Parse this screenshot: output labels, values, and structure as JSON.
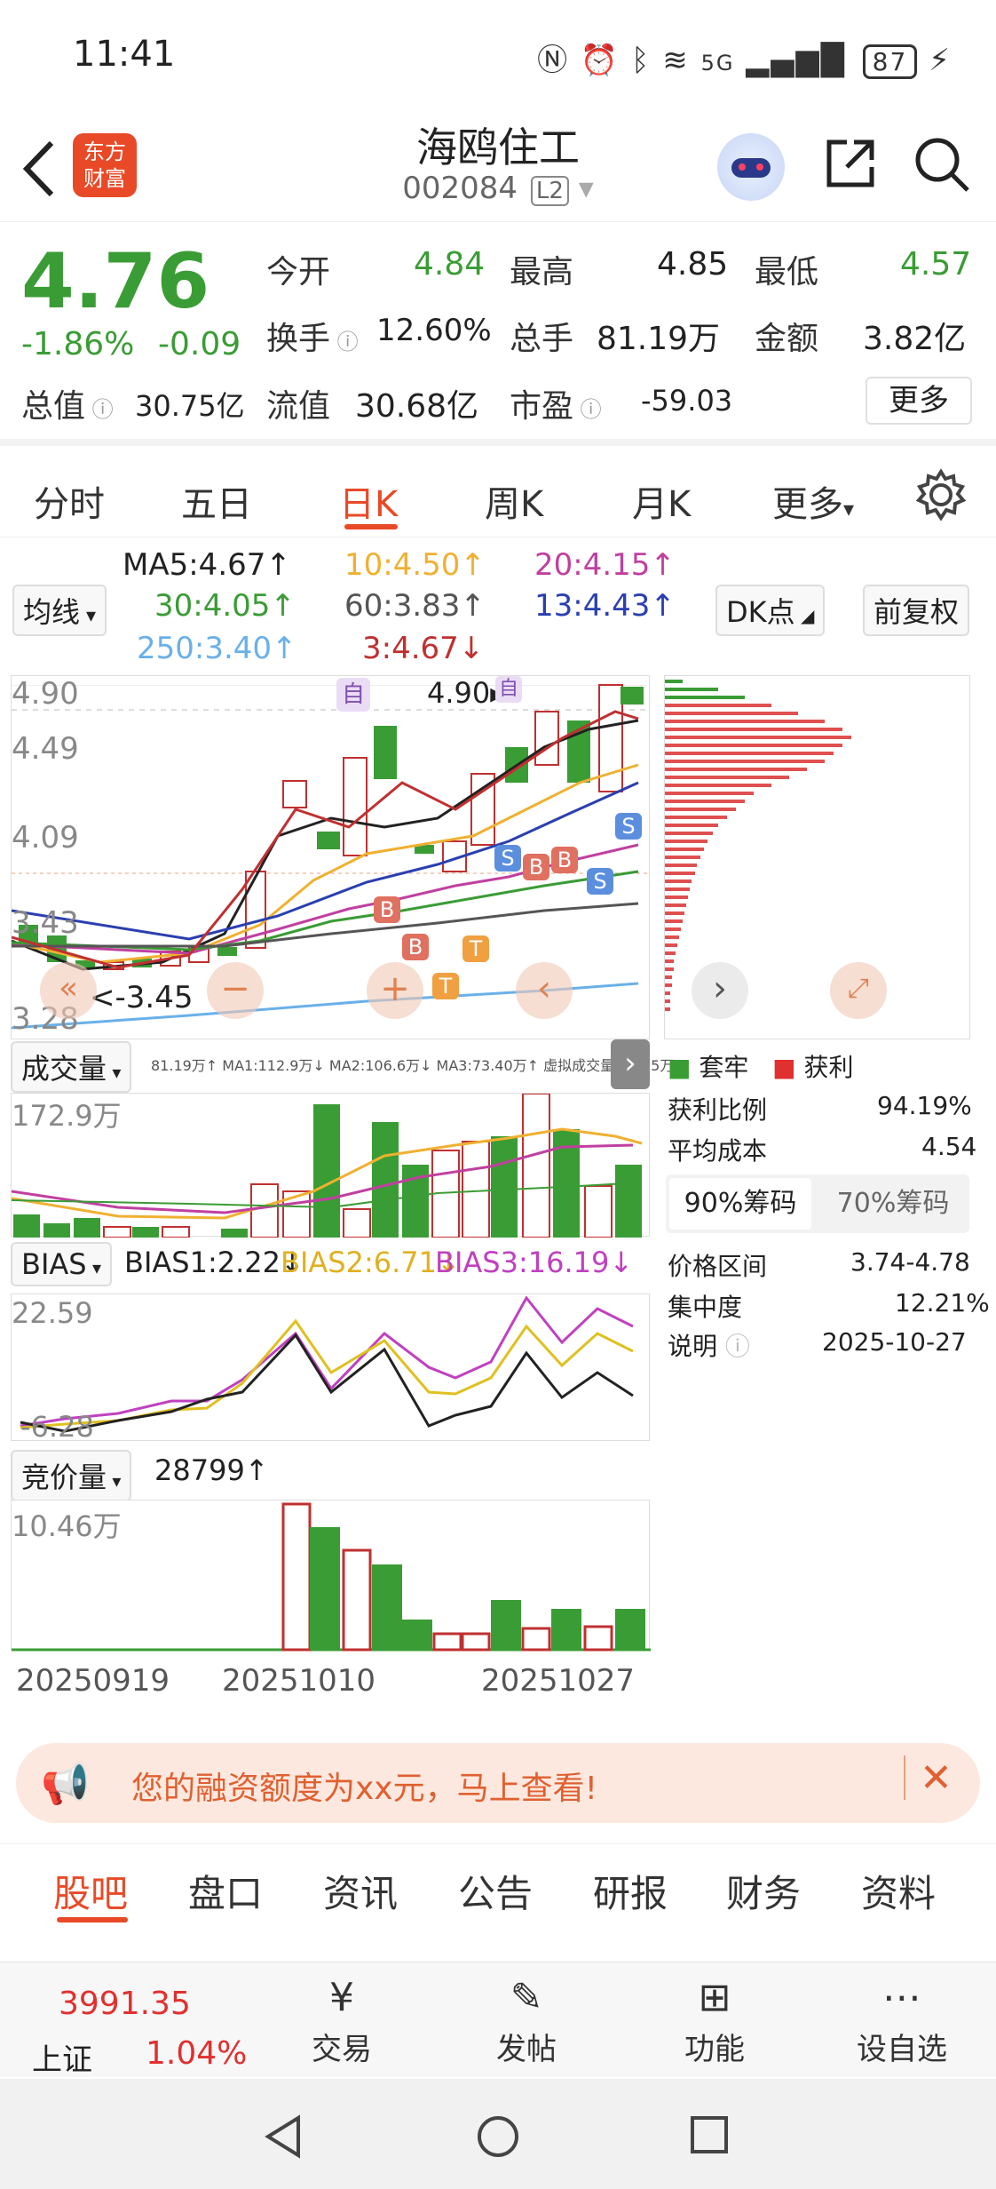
{
  "status": {
    "time": "11:41",
    "network": "5G",
    "battery": "87"
  },
  "header": {
    "title": "海鸥住工",
    "code": "002084",
    "level": "L2",
    "logo_text": "东方\n财富"
  },
  "quote": {
    "price": "4.76",
    "change_pct": "-1.86%",
    "change": "-0.09",
    "fields": [
      {
        "label": "今开",
        "value": "4.84",
        "color": "green"
      },
      {
        "label": "最高",
        "value": "4.85",
        "color": "normal"
      },
      {
        "label": "最低",
        "value": "4.57",
        "color": "green"
      },
      {
        "label": "换手",
        "value": "12.60%",
        "color": "normal"
      },
      {
        "label": "总手",
        "value": "81.19万",
        "color": "normal"
      },
      {
        "label": "金额",
        "value": "3.82亿",
        "color": "normal"
      },
      {
        "label": "总值",
        "value": "30.75亿",
        "color": "normal"
      },
      {
        "label": "流值",
        "value": "30.68亿",
        "color": "normal"
      },
      {
        "label": "市盈",
        "value": "-59.03",
        "color": "normal"
      }
    ],
    "more_label": "更多"
  },
  "tabs": [
    "分时",
    "五日",
    "日K",
    "周K",
    "月K",
    "更多"
  ],
  "ma": {
    "selector": "均线",
    "items": [
      {
        "text": "MA5:4.67↑",
        "color": "#222"
      },
      {
        "text": "10:4.50↑",
        "color": "#f0b030"
      },
      {
        "text": "20:4.15↑",
        "color": "#c040a0"
      },
      {
        "text": "30:4.05↑",
        "color": "#3a9c35"
      },
      {
        "text": "60:3.83↑",
        "color": "#555"
      },
      {
        "text": "13:4.43↑",
        "color": "#2a3fb0"
      },
      {
        "text": "250:3.40↑",
        "color": "#6ab0e8"
      },
      {
        "text": "3:4.67↓",
        "color": "#c03030"
      }
    ],
    "dk_label": "DK点",
    "adjust_label": "前复权"
  },
  "kchart": {
    "price_labels": [
      "4.90",
      "4.49",
      "4.09",
      "3.43",
      "3.28"
    ],
    "high_marker": "4.90",
    "low_marker": "<-3.45",
    "self_marker": "自",
    "signals": [
      "S",
      "B",
      "T"
    ],
    "buttons": [
      "«",
      "−",
      "+",
      "‹",
      "›"
    ]
  },
  "volume": {
    "selector": "成交量",
    "info": "81.19万↑ MA1:112.9万↓ MA2:106.6万↓ MA3:73.40万↑ 虚拟成交量:84.85万",
    "max_label": "172.9万"
  },
  "bias": {
    "selector": "BIAS",
    "b1": "BIAS1:2.22↓",
    "b2": "BIAS2:6.71↓",
    "b3": "BIAS3:16.19↓",
    "max_label": "22.59",
    "min_label": "-6.28"
  },
  "auction": {
    "selector": "竞价量",
    "value": "28799↑",
    "max_label": "10.46万"
  },
  "dates": [
    "20250919",
    "20251010",
    "20251027"
  ],
  "chips": {
    "legend": [
      {
        "label": "套牢",
        "color": "#3a9c35"
      },
      {
        "label": "获利",
        "color": "#e0302f"
      }
    ],
    "rows": [
      {
        "label": "获利比例",
        "value": "94.19%"
      },
      {
        "label": "平均成本",
        "value": "4.54"
      }
    ],
    "tab90": "90%筹码",
    "tab70": "70%筹码",
    "rows2": [
      {
        "label": "价格区间",
        "value": "3.74-4.78"
      },
      {
        "label": "集中度",
        "value": "12.21%"
      },
      {
        "label": "说明",
        "value": "2025-10-27"
      }
    ]
  },
  "banner": {
    "text": "您的融资额度为xx元，马上查看!"
  },
  "bottom_tabs": [
    "股吧",
    "盘口",
    "资讯",
    "公告",
    "研报",
    "财务",
    "资料"
  ],
  "bottom_nav": {
    "index_value": "3991.35",
    "index_name": "上证",
    "index_pct": "1.04%",
    "items": [
      "交易",
      "发帖",
      "功能",
      "设自选"
    ]
  }
}
